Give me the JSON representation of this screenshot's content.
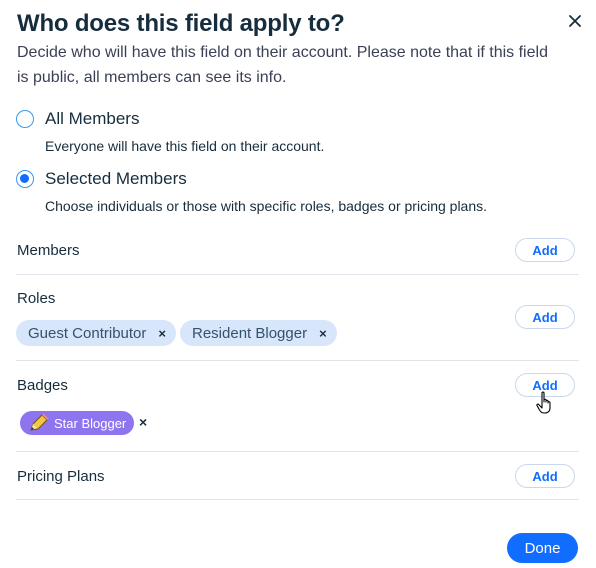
{
  "dialog": {
    "title": "Who does this field apply to?",
    "subtitle": "Decide who will have this field on their account. Please note that if this field is public, all members can see its info."
  },
  "options": [
    {
      "label": "All Members",
      "description": "Everyone will have this field on their account.",
      "selected": false
    },
    {
      "label": "Selected Members",
      "description": "Choose individuals or those with specific roles, badges or pricing plans.",
      "selected": true
    }
  ],
  "sections": {
    "members": {
      "label": "Members",
      "add_label": "Add"
    },
    "roles": {
      "label": "Roles",
      "add_label": "Add",
      "chips": [
        {
          "label": "Guest Contributor",
          "remove": "×"
        },
        {
          "label": "Resident Blogger",
          "remove": "×"
        }
      ]
    },
    "badges": {
      "label": "Badges",
      "add_label": "Add",
      "items": [
        {
          "label": "Star Blogger",
          "icon": "pencil-icon",
          "color": "#8e74ef",
          "remove": "×"
        }
      ]
    },
    "pricing": {
      "label": "Pricing Plans",
      "add_label": "Add"
    }
  },
  "footer": {
    "done_label": "Done"
  },
  "colors": {
    "accent": "#116dff",
    "chip_bg": "#d8e6fb",
    "badge_bg": "#8e74ef",
    "divider": "#dfe5eb"
  }
}
